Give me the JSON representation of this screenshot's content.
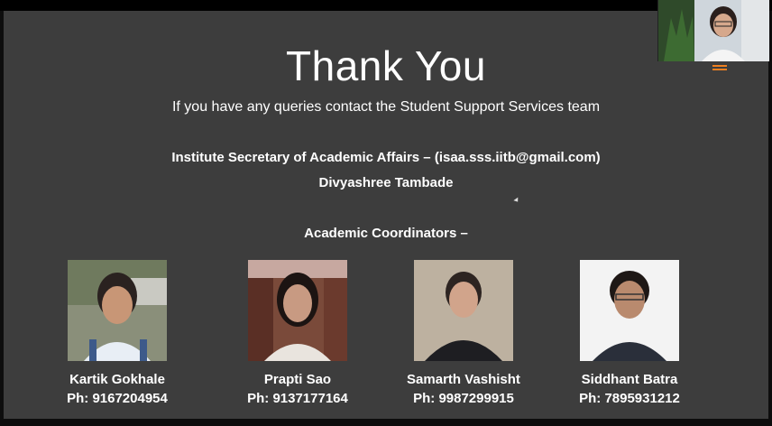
{
  "slide": {
    "title": "Thank You",
    "subtitle": "If you have any queries contact the Student Support Services team",
    "secretary_line": "Institute Secretary of Academic Affairs – (isaa.sss.iitb@gmail.com)",
    "secretary_name": "Divyashree Tambade",
    "coordinators_heading": "Academic Coordinators –",
    "coordinators": [
      {
        "name": "Kartik Gokhale",
        "phone": "Ph: 9167204954"
      },
      {
        "name": "Prapti Sao",
        "phone": "Ph: 9137177164"
      },
      {
        "name": "Samarth Vashisht",
        "phone": "Ph: 9987299915"
      },
      {
        "name": "Siddhant Batra",
        "phone": "Ph: 7895931212"
      }
    ]
  },
  "colors": {
    "slide_bg": "#3d3d3d",
    "text": "#ffffff",
    "accent": "#f08020"
  },
  "icons": [
    "cursor-icon"
  ]
}
